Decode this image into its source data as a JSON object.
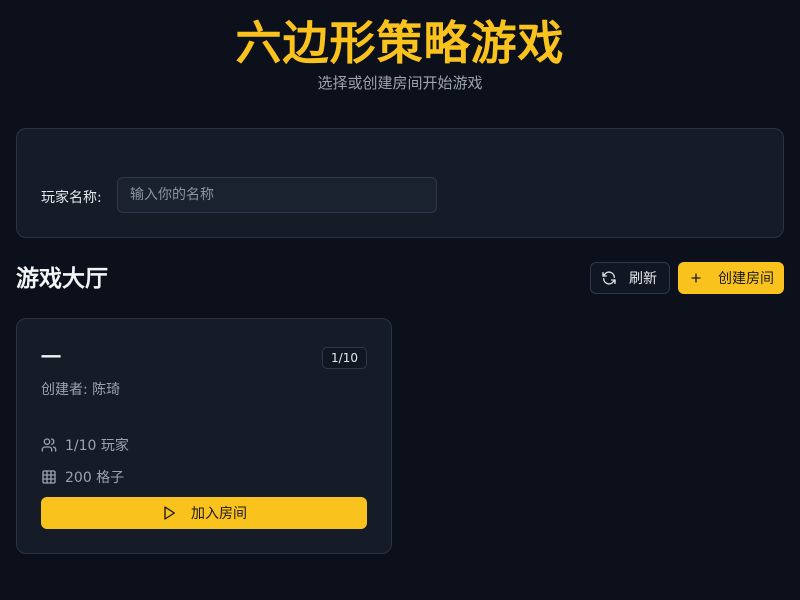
{
  "header": {
    "title": "六边形策略游戏",
    "subtitle": "选择或创建房间开始游戏"
  },
  "player": {
    "label": "玩家名称:",
    "placeholder": "输入你的名称",
    "value": ""
  },
  "lobby": {
    "title": "游戏大厅",
    "refresh_label": "刷新",
    "create_label": "创建房间"
  },
  "rooms": [
    {
      "name": "一",
      "badge": "1/10",
      "creator": "创建者: 陈琦",
      "players": "1/10 玩家",
      "cells": "200 格子",
      "join_label": "加入房间"
    }
  ],
  "icons": {
    "refresh": "refresh-icon",
    "create": "plus-icon",
    "players": "users-icon",
    "cells": "grid-icon",
    "join": "play-icon"
  },
  "colors": {
    "accent": "#fac21d",
    "background": "#0b101a",
    "card": "#151c28"
  }
}
